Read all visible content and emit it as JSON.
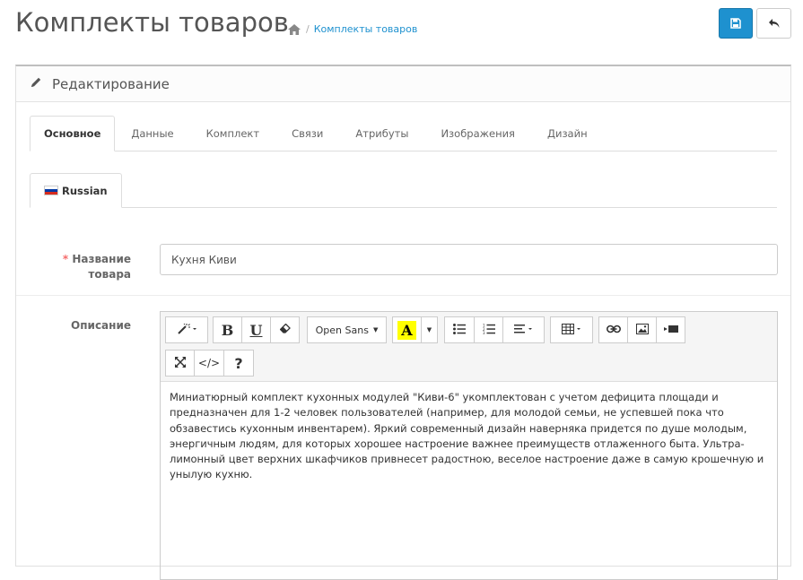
{
  "header": {
    "title": "Комплекты товаров",
    "breadcrumb": [
      "Комплекты товаров"
    ]
  },
  "panel": {
    "heading": "Редактирование"
  },
  "tabs": [
    {
      "label": "Основное",
      "active": true
    },
    {
      "label": "Данные"
    },
    {
      "label": "Комплект"
    },
    {
      "label": "Связи"
    },
    {
      "label": "Атрибуты"
    },
    {
      "label": "Изображения"
    },
    {
      "label": "Дизайн"
    }
  ],
  "language_tab": {
    "label": "Russian"
  },
  "form": {
    "name_label_line1": "Название",
    "name_label_line2": "товара",
    "name_required_mark": "*",
    "name_value": "Кухня Киви",
    "description_label": "Описание"
  },
  "editor": {
    "font_select": "Open Sans",
    "bold": "B",
    "underline": "U",
    "help": "?",
    "code": "</>",
    "content": "Миниатюрный комплект кухонных модулей \"Киви-6\" укомплектован с учетом дефицита площади и предназначен для 1-2 человек пользователей (например, для молодой семьи, не успевшей пока что обзавестись кухонным инвентарем). Яркий современный дизайн наверняка придется по душе молодым, энергичным людям, для которых хорошее настроение важнее преимуществ отлаженного быта. Ультра-лимонный цвет верхних шкафчиков привнесет радостною, веселое настроение даже в самую крошечную и унылую кухню."
  },
  "colors": {
    "primary": "#1e91cf",
    "link": "#1e91cf",
    "required": "#f56b6b",
    "highlight": "#ffff00"
  }
}
